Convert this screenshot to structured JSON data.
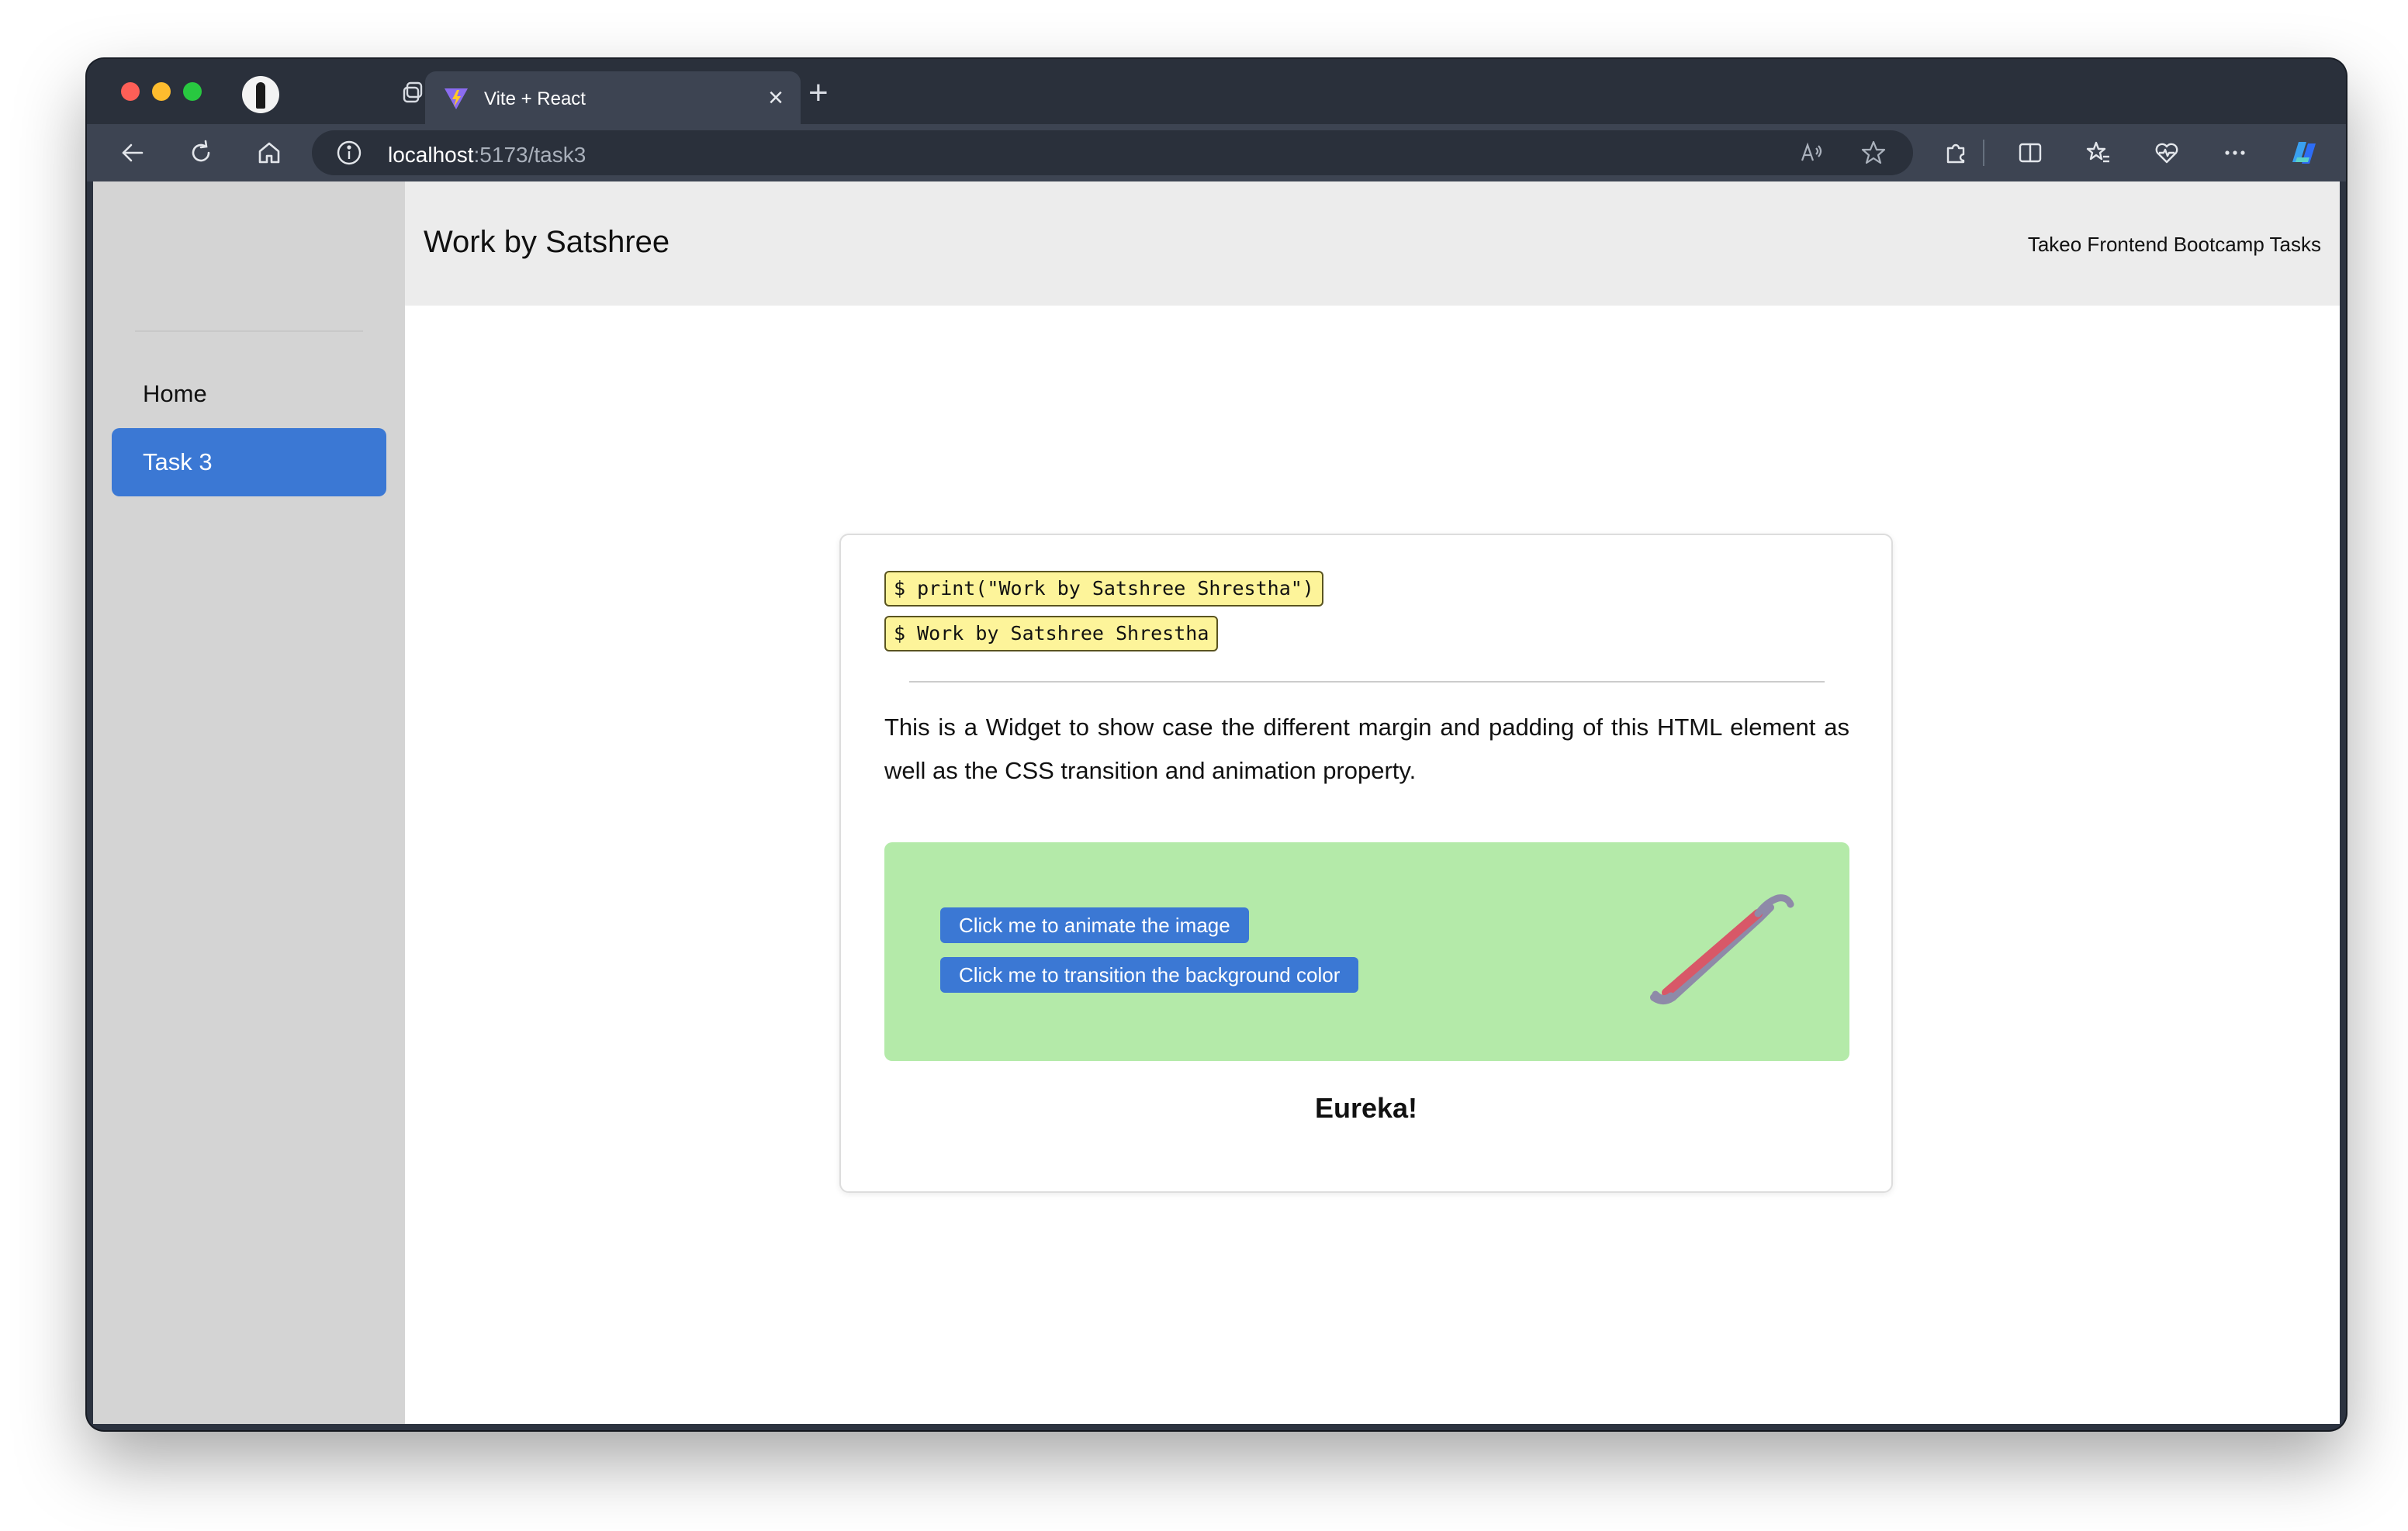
{
  "browser": {
    "tab_title": "Vite + React",
    "tab_close": "×",
    "new_tab": "+",
    "url_host": "localhost",
    "url_path": ":5173/task3"
  },
  "sidebar": {
    "items": [
      {
        "label": "Home",
        "active": false
      },
      {
        "label": "Task 3",
        "active": true
      }
    ]
  },
  "header": {
    "title": "Work by Satshree",
    "right_text": "Takeo Frontend Bootcamp Tasks"
  },
  "widget": {
    "code_lines": [
      "$ print(\"Work by Satshree Shrestha\")",
      "$ Work by Satshree Shrestha"
    ],
    "description": "This is a Widget to show case the different margin and padding of this HTML element as well as the CSS transition and animation property.",
    "buttons": {
      "animate_label": "Click me to animate the image",
      "transition_label": "Click me to transition the background color"
    },
    "image_icon": "crowbar-icon",
    "caption": "Eureka!"
  },
  "colors": {
    "accent": "#3b78d4",
    "widget_bg": "#b4eaa9",
    "code_bg": "#fdf49a",
    "sidebar_bg": "#d4d4d4",
    "header_bg": "#ececec"
  }
}
